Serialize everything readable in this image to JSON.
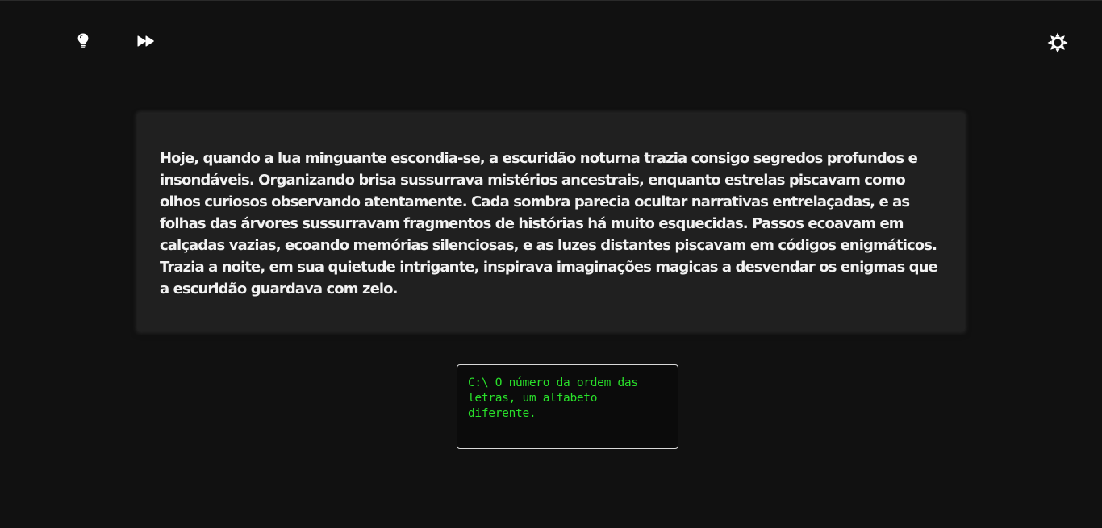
{
  "toolbar": {
    "hint_icon": "lightbulb-icon",
    "skip_icon": "fast-forward-icon",
    "theme_icon": "sun-icon"
  },
  "story": {
    "text": "Hoje, quando a lua minguante escondia-se, a escuridão noturna trazia consigo segredos profundos e insondáveis. Organizando brisa sussurrava mistérios ancestrais, enquanto estrelas piscavam como olhos curiosos observando atentamente. Cada sombra parecia ocultar narrativas entrelaçadas, e as folhas das árvores sussurravam fragmentos de histórias há muito esquecidas. Passos ecoavam em calçadas vazias, ecoando memórias silenciosas, e as luzes distantes piscavam em códigos enigmáticos. Trazia a noite, em sua quietude intrigante, inspirava imaginações magicas a desvendar os enigmas que a escuridão guardava com zelo."
  },
  "terminal": {
    "text": "C:\\ O número da ordem das letras, um alfabeto diferente."
  },
  "colors": {
    "background": "#111111",
    "card": "#202020",
    "story_text": "#f2f2f2",
    "terminal_text": "#29e02a",
    "terminal_border": "#d9d9d9"
  }
}
